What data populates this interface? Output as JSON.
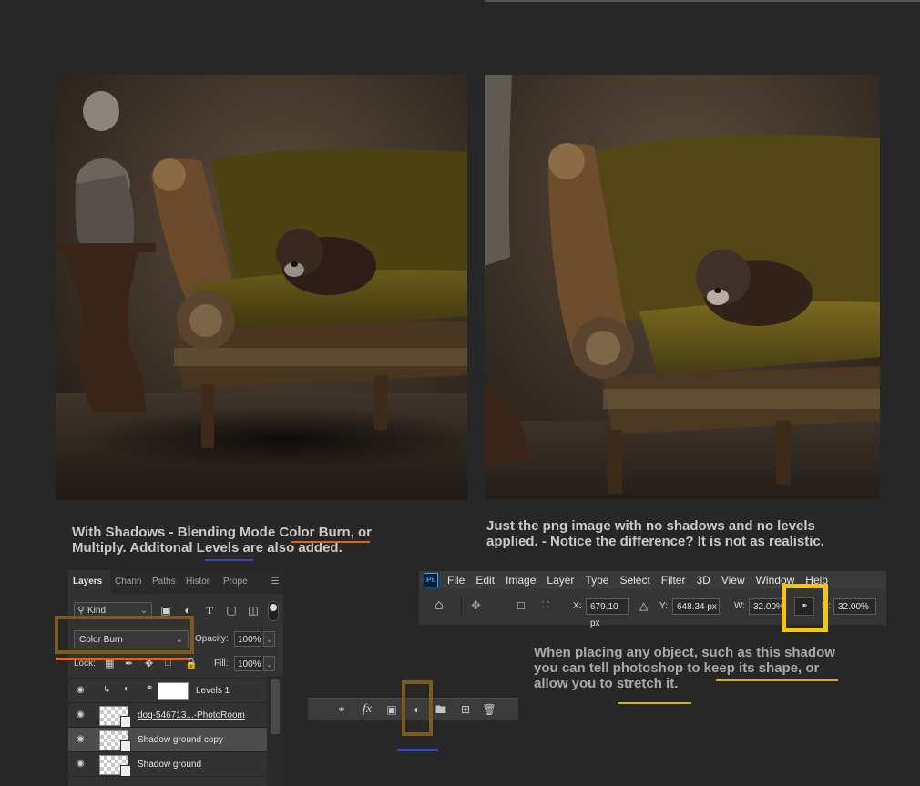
{
  "captions": {
    "left_l1_pre": "With Shadows - Blending Mode ",
    "left_l1_mid": "Color Burn",
    "left_l1_post": ", or",
    "left_l2_pre": "Multiply.  Additonal ",
    "left_l2_mid": "Levels",
    "left_l2_post": " are also added.",
    "right_l1": "Just the png image with no shadows and no levels",
    "right_l2": "applied.  - Notice the difference?  It is not as realistic.",
    "place_l1": "When placing any object, such as this shadow",
    "place_l2_pre": "you can tell photoshop to ",
    "place_l2_mid": "keep its shape, or",
    "place_l3_pre": "allow you to ",
    "place_l3_mid": "stretch it."
  },
  "layers_panel": {
    "tabs": [
      "Layers",
      "Chann",
      "Paths",
      "Histor",
      "Prope"
    ],
    "kind_label": "Kind",
    "blend_mode": "Color Burn",
    "opacity_label": "Opacity:",
    "opacity_value": "100%",
    "lock_label": "Lock:",
    "fill_label": "Fill:",
    "fill_value": "100%",
    "layers": [
      {
        "name": "Levels 1"
      },
      {
        "name": "dog-546713...-PhotoRoom"
      },
      {
        "name": "Shadow ground copy"
      },
      {
        "name": "Shadow ground"
      }
    ]
  },
  "photoshop_bar": {
    "logo": "Ps",
    "menu": [
      "File",
      "Edit",
      "Image",
      "Layer",
      "Type",
      "Select",
      "Filter",
      "3D",
      "View",
      "Window",
      "Help"
    ],
    "x_label": "X:",
    "x_value": "679.10 px",
    "y_label": "Y:",
    "y_value": "648.34 px",
    "w_label": "W:",
    "w_value": "32.00%",
    "h_label": "H:",
    "h_value": "32.00%"
  },
  "layer_toolbar": {
    "fx_label": "fx"
  },
  "colors": {
    "highlight_brown": "#7a5a1e",
    "highlight_yellow": "#f2c318",
    "underline_orange": "#e0641c",
    "underline_blue": "#3a46c8",
    "underline_yellow": "#d8b020"
  }
}
